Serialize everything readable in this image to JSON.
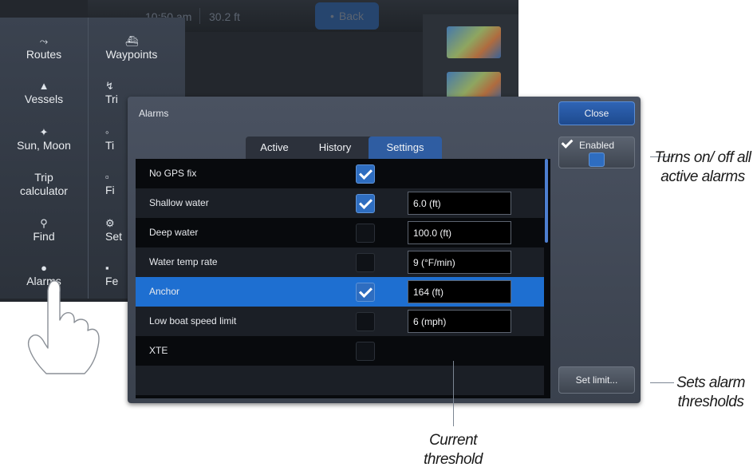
{
  "background": {
    "time": "10:50 am",
    "depth": "30.2 ft",
    "back_label": "Back",
    "menu": [
      {
        "label": "Routes",
        "icon": "routes-icon"
      },
      {
        "label": "Waypoints",
        "icon": "waypoints-icon"
      },
      {
        "label": "Vessels",
        "icon": "vessels-icon"
      },
      {
        "label": "Tri",
        "icon": "trails-icon"
      },
      {
        "label": "Sun, Moon",
        "icon": "sun-moon-icon"
      },
      {
        "label": "Ti",
        "icon": "tides-icon"
      },
      {
        "label": "Trip calculator",
        "icon": "trip-calculator-icon"
      },
      {
        "label": "Fi",
        "icon": "files-icon"
      },
      {
        "label": "Find",
        "icon": "find-icon"
      },
      {
        "label": "Set",
        "icon": "settings-icon"
      },
      {
        "label": "Alarms",
        "icon": "alarms-icon"
      },
      {
        "label": "Fe",
        "icon": "features-icon"
      }
    ]
  },
  "dialog": {
    "title": "Alarms",
    "close_label": "Close",
    "enabled_label": "Enabled",
    "enabled_checked": true,
    "set_limit_label": "Set limit...",
    "tabs": [
      {
        "label": "Active",
        "active": false
      },
      {
        "label": "History",
        "active": false
      },
      {
        "label": "Settings",
        "active": true
      }
    ],
    "rows": [
      {
        "label": "No GPS fix",
        "checked": true,
        "value": ""
      },
      {
        "label": "Shallow water",
        "checked": true,
        "value": "6.0 (ft)"
      },
      {
        "label": "Deep water",
        "checked": false,
        "value": "100.0 (ft)"
      },
      {
        "label": "Water temp rate",
        "checked": false,
        "value": "9 (°F/min)"
      },
      {
        "label": "Anchor",
        "checked": true,
        "value": "164 (ft)",
        "selected": true
      },
      {
        "label": "Low boat speed limit",
        "checked": false,
        "value": "6 (mph)"
      },
      {
        "label": "XTE",
        "checked": false,
        "value": ""
      }
    ]
  },
  "callouts": {
    "enabled": "Turns on/ off all active alarms",
    "set_limit": "Sets alarm thresholds",
    "threshold": "Current threshold"
  },
  "colors": {
    "accent": "#2f5da2",
    "selected_row": "#1e6fd1"
  }
}
